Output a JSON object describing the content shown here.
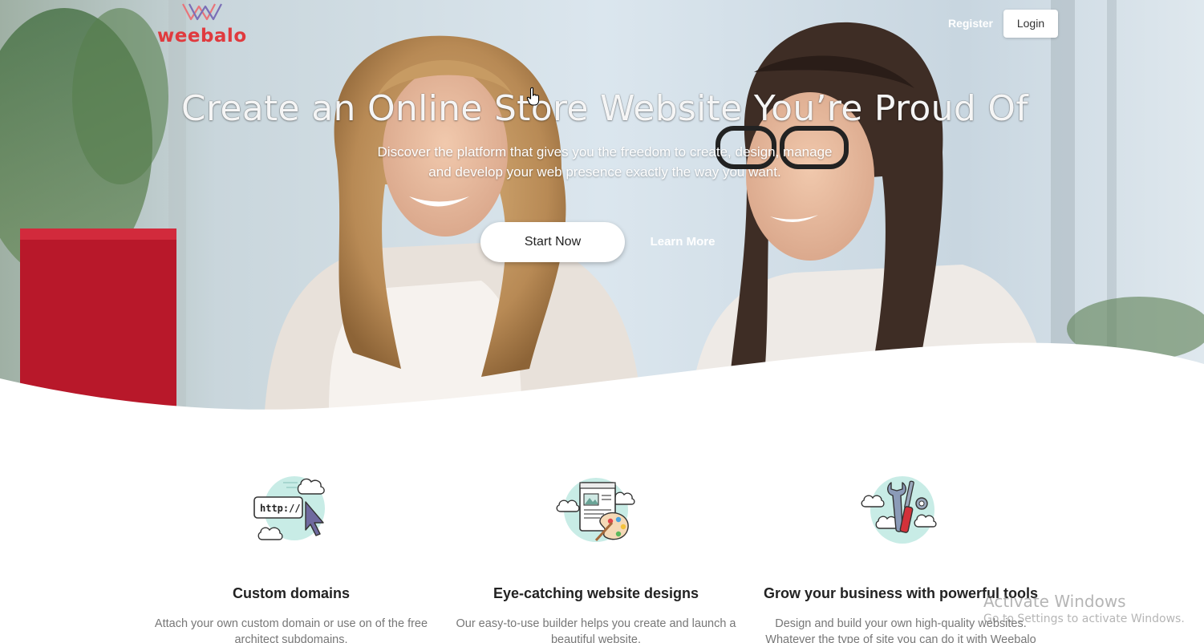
{
  "brand": {
    "logo_text": "weebalo",
    "accent_color": "#e03a3e"
  },
  "nav": {
    "register_label": "Register",
    "login_label": "Login"
  },
  "hero": {
    "title": "Create an Online Store Website You’re Proud Of",
    "subtitle_line1": "Discover the platform that gives you the freedom to create, design, manage",
    "subtitle_line2": "and develop your web presence exactly the way you want.",
    "start_label": "Start Now",
    "learn_label": "Learn More",
    "background": "photo of two smiling women looking at a laptop in a bright office"
  },
  "features": [
    {
      "icon": "domain-icon",
      "icon_text": "http://",
      "title": "Custom domains",
      "desc_line1": "Attach your own custom domain or use on of the free",
      "desc_line2": "architect subdomains."
    },
    {
      "icon": "design-icon",
      "title": "Eye-catching website designs",
      "desc_line1": "Our easy-to-use builder helps you create and launch a",
      "desc_line2": "beautiful website."
    },
    {
      "icon": "tools-icon",
      "title": "Grow your business with powerful tools",
      "desc_line1": "Design and build your own high-quality websites.",
      "desc_line2": "Whatever the type of site you can do it with Weebalo"
    }
  ],
  "watermark": {
    "title": "Activate Windows",
    "subtitle": "Go to Settings to activate Windows."
  }
}
